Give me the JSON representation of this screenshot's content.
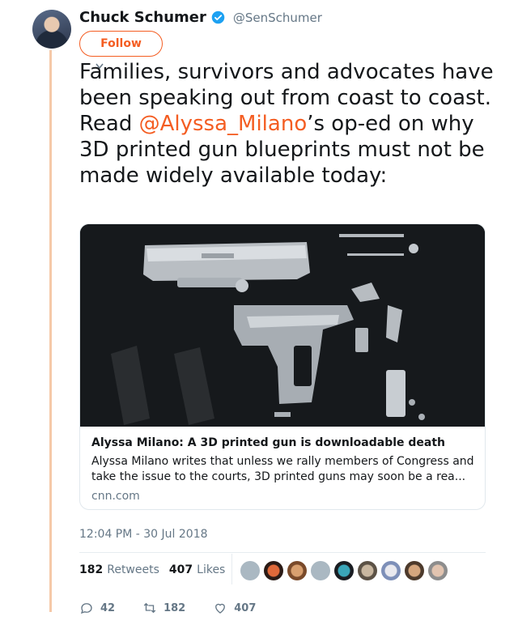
{
  "author": {
    "display_name": "Chuck Schumer",
    "handle": "@SenSchumer",
    "verified": true,
    "avatar_icon": "profile-photo"
  },
  "follow_button": {
    "label": "Follow"
  },
  "tweet": {
    "text_before": "Families, survivors and advocates have been speaking out from coast to coast. Read ",
    "mention": "@Alyssa_Milano",
    "text_after": "’s op-ed on why 3D printed gun blueprints must not be made widely available today:"
  },
  "card": {
    "image_icon": "disassembled-pistol-photo",
    "title": "Alyssa Milano: A 3D printed gun is downloadable death",
    "description": "Alyssa Milano writes that unless we rally members of Congress and take the issue to the courts, 3D printed guns may soon be a rea...",
    "domain": "cnn.com"
  },
  "timestamp": "12:04 PM - 30 Jul 2018",
  "stats": {
    "retweets_count": "182",
    "retweets_label": "Retweets",
    "likes_count": "407",
    "likes_label": "Likes"
  },
  "actions": {
    "reply_count": "42",
    "retweet_count": "182",
    "like_count": "407"
  },
  "colors": {
    "accent": "#f45d22",
    "thread_line": "#f5c9a8",
    "muted": "#657786",
    "verified": "#1da1f2"
  }
}
